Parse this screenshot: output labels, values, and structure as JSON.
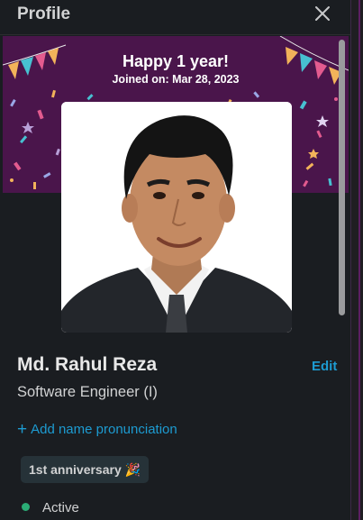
{
  "header": {
    "title": "Profile"
  },
  "banner": {
    "headline": "Happy 1 year!",
    "joined": "Joined on: Mar 28, 2023"
  },
  "profile": {
    "name": "Md. Rahul Reza",
    "edit_label": "Edit",
    "title": "Software Engineer (I)",
    "add_pronunciation": "Add name pronunciation",
    "badge": "1st anniversary 🎉",
    "status": "Active"
  },
  "colors": {
    "banner": "#4a154b",
    "link": "#1d9bd1",
    "status_active": "#2bac76",
    "background": "#1a1d21"
  },
  "icons": {
    "close": "close-icon",
    "add": "plus-icon",
    "status": "status-dot-icon"
  }
}
